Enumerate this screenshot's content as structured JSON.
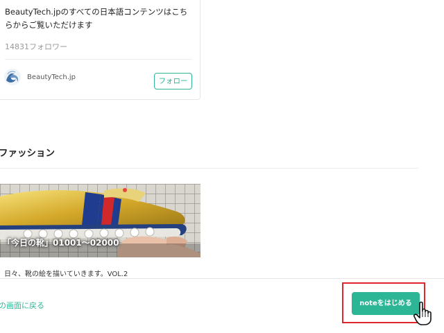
{
  "profile_card": {
    "description": "BeautyTech.jpのすべての日本語コンテンツはこちらからご覧いただけます",
    "followers": "14831フォロワー",
    "author_name": "BeautyTech.jp",
    "follow_label": "フォロー"
  },
  "section": {
    "title": "ファッション"
  },
  "article": {
    "title": "「今日の靴」01001〜02000",
    "excerpt": "日々、靴の絵を描いていきます。VOL.2"
  },
  "bottom_bar": {
    "back_label": "の画面に戻る",
    "start_label": "noteをはじめる"
  },
  "colors": {
    "accent": "#2cb696",
    "highlight": "#e0262c"
  },
  "icons": {
    "avatar": "wave-logo-icon",
    "cursor": "hand-pointer-icon"
  }
}
